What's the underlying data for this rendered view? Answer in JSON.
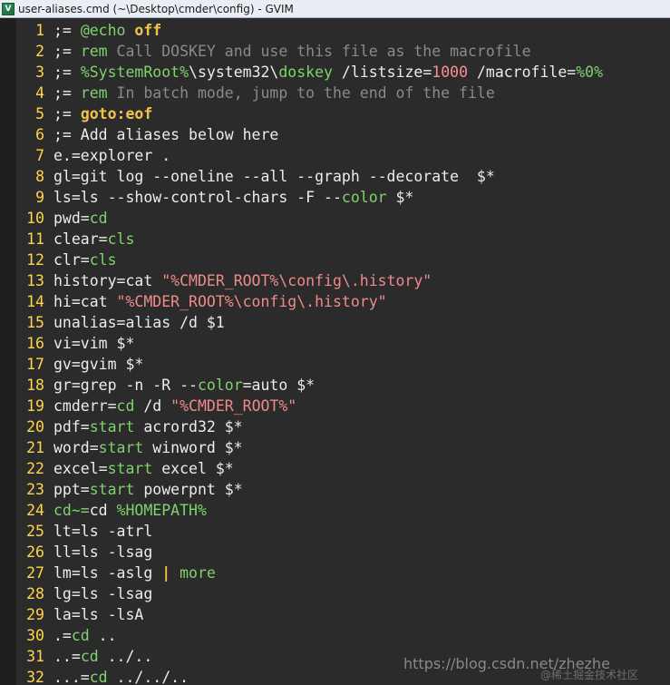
{
  "window": {
    "title": "user-aliases.cmd (~\\Desktop\\cmder\\config) - GVIM",
    "icon": "vim-icon"
  },
  "watermark": {
    "url": "https://blog.csdn.net/zhezhe",
    "site": "@稀土掘金技术社区"
  },
  "colors": {
    "background": "#2b2b2b",
    "line_number": "#ffd54a",
    "keyword": "#f0c34a",
    "comment": "#8a8a8a",
    "command": "#7fd26e",
    "string": "#f08a8a"
  },
  "lines": [
    {
      "n": "1",
      "tokens": [
        {
          "t": ";= ",
          "c": "default"
        },
        {
          "t": "@echo",
          "c": "cmd"
        },
        {
          "t": " ",
          "c": "default"
        },
        {
          "t": "off",
          "c": "kw"
        }
      ]
    },
    {
      "n": "2",
      "tokens": [
        {
          "t": ";= ",
          "c": "default"
        },
        {
          "t": "rem",
          "c": "cmd"
        },
        {
          "t": " Call DOSKEY and use this file as the macrofile",
          "c": "comment"
        }
      ]
    },
    {
      "n": "3",
      "tokens": [
        {
          "t": ";= ",
          "c": "default"
        },
        {
          "t": "%SystemRoot%",
          "c": "cmd"
        },
        {
          "t": "\\system32\\",
          "c": "default"
        },
        {
          "t": "doskey",
          "c": "cmd"
        },
        {
          "t": " /listsize=",
          "c": "default"
        },
        {
          "t": "1000",
          "c": "num"
        },
        {
          "t": " /macrofile=",
          "c": "default"
        },
        {
          "t": "%0%",
          "c": "cmd"
        }
      ]
    },
    {
      "n": "4",
      "tokens": [
        {
          "t": ";= ",
          "c": "default"
        },
        {
          "t": "rem",
          "c": "cmd"
        },
        {
          "t": " In batch mode, jump to the end of the file",
          "c": "comment"
        }
      ]
    },
    {
      "n": "5",
      "tokens": [
        {
          "t": ";= ",
          "c": "default"
        },
        {
          "t": "goto:eof",
          "c": "kw"
        }
      ]
    },
    {
      "n": "6",
      "tokens": [
        {
          "t": ";= Add aliases below here",
          "c": "default"
        }
      ]
    },
    {
      "n": "7",
      "tokens": [
        {
          "t": "e.=explorer .",
          "c": "default"
        }
      ]
    },
    {
      "n": "8",
      "tokens": [
        {
          "t": "gl=git log --oneline --all --graph --decorate  $*",
          "c": "default"
        }
      ]
    },
    {
      "n": "9",
      "tokens": [
        {
          "t": "ls=ls --show-control-chars -F --",
          "c": "default"
        },
        {
          "t": "color",
          "c": "cmd"
        },
        {
          "t": " $*",
          "c": "default"
        }
      ]
    },
    {
      "n": "10",
      "tokens": [
        {
          "t": "pwd=",
          "c": "default"
        },
        {
          "t": "cd",
          "c": "cmd"
        }
      ]
    },
    {
      "n": "11",
      "tokens": [
        {
          "t": "clear=",
          "c": "default"
        },
        {
          "t": "cls",
          "c": "cmd"
        }
      ]
    },
    {
      "n": "12",
      "tokens": [
        {
          "t": "clr=",
          "c": "default"
        },
        {
          "t": "cls",
          "c": "cmd"
        }
      ]
    },
    {
      "n": "13",
      "tokens": [
        {
          "t": "history=cat ",
          "c": "default"
        },
        {
          "t": "\"%CMDER_ROOT%\\config\\.history\"",
          "c": "str"
        }
      ]
    },
    {
      "n": "14",
      "tokens": [
        {
          "t": "hi=cat ",
          "c": "default"
        },
        {
          "t": "\"%CMDER_ROOT%\\config\\.history\"",
          "c": "str"
        }
      ]
    },
    {
      "n": "15",
      "tokens": [
        {
          "t": "unalias=alias /d $1",
          "c": "default"
        }
      ]
    },
    {
      "n": "16",
      "tokens": [
        {
          "t": "vi=vim $*",
          "c": "default"
        }
      ]
    },
    {
      "n": "17",
      "tokens": [
        {
          "t": "gv=gvim $*",
          "c": "default"
        }
      ]
    },
    {
      "n": "18",
      "tokens": [
        {
          "t": "gr=grep -n -R --",
          "c": "default"
        },
        {
          "t": "color",
          "c": "cmd"
        },
        {
          "t": "=auto $*",
          "c": "default"
        }
      ]
    },
    {
      "n": "19",
      "tokens": [
        {
          "t": "cmderr=",
          "c": "default"
        },
        {
          "t": "cd",
          "c": "cmd"
        },
        {
          "t": " /d ",
          "c": "default"
        },
        {
          "t": "\"%CMDER_ROOT%\"",
          "c": "str"
        }
      ]
    },
    {
      "n": "20",
      "tokens": [
        {
          "t": "pdf=",
          "c": "default"
        },
        {
          "t": "start",
          "c": "cmd"
        },
        {
          "t": " acrord32 $*",
          "c": "default"
        }
      ]
    },
    {
      "n": "21",
      "tokens": [
        {
          "t": "word=",
          "c": "default"
        },
        {
          "t": "start",
          "c": "cmd"
        },
        {
          "t": " winword $*",
          "c": "default"
        }
      ]
    },
    {
      "n": "22",
      "tokens": [
        {
          "t": "excel=",
          "c": "default"
        },
        {
          "t": "start",
          "c": "cmd"
        },
        {
          "t": " excel $*",
          "c": "default"
        }
      ]
    },
    {
      "n": "23",
      "tokens": [
        {
          "t": "ppt=",
          "c": "default"
        },
        {
          "t": "start",
          "c": "cmd"
        },
        {
          "t": " powerpnt $*",
          "c": "default"
        }
      ]
    },
    {
      "n": "24",
      "tokens": [
        {
          "t": "cd~=",
          "c": "cmd"
        },
        {
          "t": "cd",
          "c": "default"
        },
        {
          "t": " ",
          "c": "default"
        },
        {
          "t": "%HOMEPATH%",
          "c": "cmd"
        }
      ]
    },
    {
      "n": "25",
      "tokens": [
        {
          "t": "lt=ls -atrl",
          "c": "default"
        }
      ]
    },
    {
      "n": "26",
      "tokens": [
        {
          "t": "ll=ls -lsag",
          "c": "default"
        }
      ]
    },
    {
      "n": "27",
      "tokens": [
        {
          "t": "lm=ls -aslg ",
          "c": "default"
        },
        {
          "t": "|",
          "c": "kw"
        },
        {
          "t": " ",
          "c": "default"
        },
        {
          "t": "more",
          "c": "cmd"
        }
      ]
    },
    {
      "n": "28",
      "tokens": [
        {
          "t": "lg=ls -lsag",
          "c": "default"
        }
      ]
    },
    {
      "n": "29",
      "tokens": [
        {
          "t": "la=ls -lsA",
          "c": "default"
        }
      ]
    },
    {
      "n": "30",
      "tokens": [
        {
          "t": ".=",
          "c": "default"
        },
        {
          "t": "cd",
          "c": "cmd"
        },
        {
          "t": " ..",
          "c": "default"
        }
      ]
    },
    {
      "n": "31",
      "tokens": [
        {
          "t": "..=",
          "c": "default"
        },
        {
          "t": "cd",
          "c": "cmd"
        },
        {
          "t": " ../..",
          "c": "default"
        }
      ]
    },
    {
      "n": "32",
      "tokens": [
        {
          "t": "...=",
          "c": "default"
        },
        {
          "t": "cd",
          "c": "cmd"
        },
        {
          "t": " ../../..",
          "c": "default"
        }
      ]
    }
  ]
}
